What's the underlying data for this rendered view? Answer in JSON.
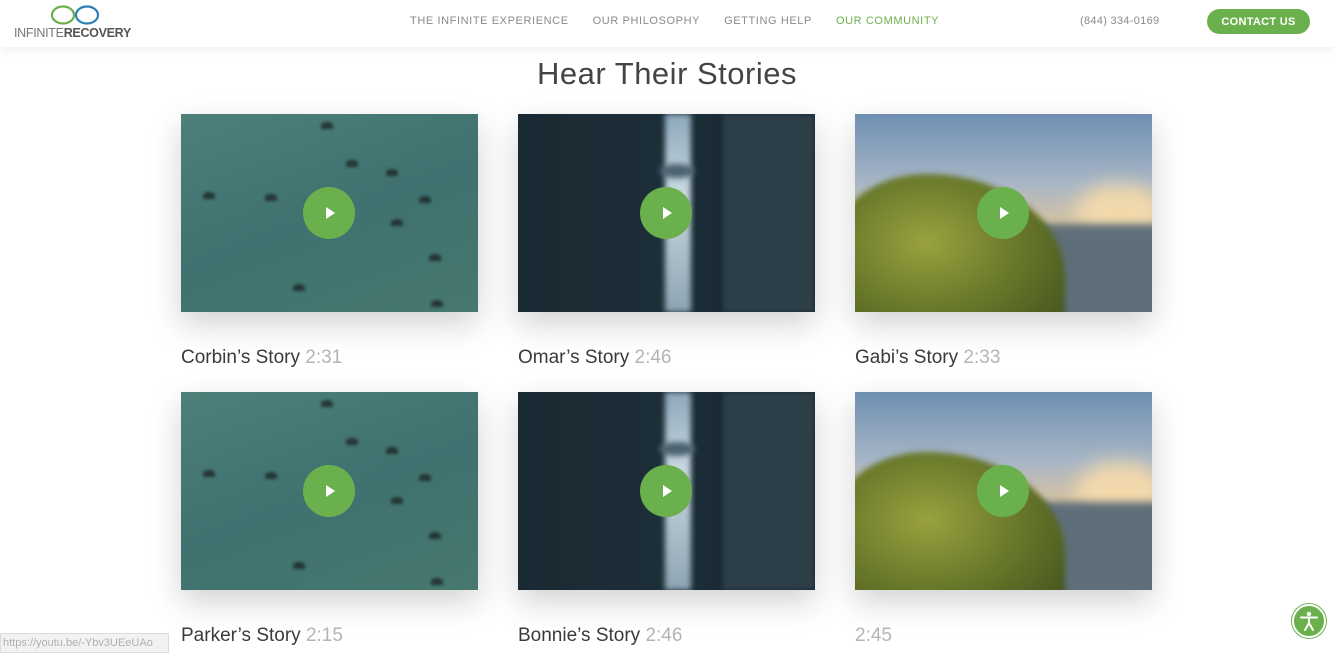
{
  "header": {
    "logo": {
      "part1": "INFINITE",
      "part2": "RECOVERY"
    },
    "nav": [
      {
        "label": "THE INFINITE EXPERIENCE",
        "active": false
      },
      {
        "label": "OUR PHILOSOPHY",
        "active": false
      },
      {
        "label": "GETTING HELP",
        "active": false
      },
      {
        "label": "OUR COMMUNITY",
        "active": true
      }
    ],
    "phone": "(844) 334-0169",
    "contact_label": "CONTACT US"
  },
  "main": {
    "heading": "Hear Their Stories",
    "videos": [
      {
        "name": "Corbin’s Story",
        "duration": "2:31",
        "thumbnail": "birds"
      },
      {
        "name": "Omar’s Story",
        "duration": "2:46",
        "thumbnail": "city"
      },
      {
        "name": "Gabi’s Story",
        "duration": "2:33",
        "thumbnail": "coast"
      },
      {
        "name": "Parker’s Story",
        "duration": "2:15",
        "thumbnail": "birds"
      },
      {
        "name": "Bonnie’s Story",
        "duration": "2:46",
        "thumbnail": "city"
      },
      {
        "name": "",
        "duration": "2:45",
        "thumbnail": "coast"
      }
    ]
  },
  "status_bar": {
    "url": "https://youtu.be/-Ybv3UEeUAo"
  },
  "colors": {
    "accent": "#6ab04c",
    "text": "#3a3a3a",
    "muted": "#b4b4b4"
  }
}
